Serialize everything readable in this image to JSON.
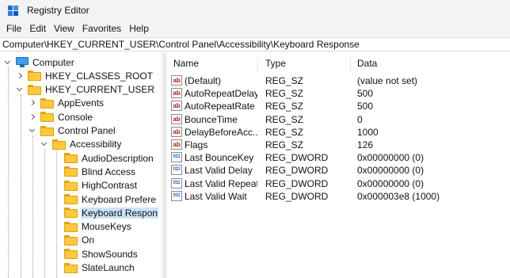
{
  "window": {
    "title": "Registry Editor"
  },
  "menu": [
    "File",
    "Edit",
    "View",
    "Favorites",
    "Help"
  ],
  "address": "Computer\\HKEY_CURRENT_USER\\Control Panel\\Accessibility\\Keyboard Response",
  "tree": [
    {
      "label": "Computer",
      "expander": "down",
      "icon": "computer-icon"
    },
    {
      "label": "HKEY_CLASSES_ROOT",
      "expander": "right",
      "icon": "folder-icon"
    },
    {
      "label": "HKEY_CURRENT_USER",
      "expander": "down",
      "icon": "folder-icon"
    },
    {
      "label": "AppEvents",
      "expander": "right",
      "icon": "folder-icon"
    },
    {
      "label": "Console",
      "expander": "right",
      "icon": "folder-icon"
    },
    {
      "label": "Control Panel",
      "expander": "down",
      "icon": "folder-icon"
    },
    {
      "label": "Accessibility",
      "expander": "down",
      "icon": "folder-icon"
    },
    {
      "label": "AudioDescription",
      "expander": "none",
      "icon": "folder-icon"
    },
    {
      "label": "Blind Access",
      "expander": "none",
      "icon": "folder-icon"
    },
    {
      "label": "HighContrast",
      "expander": "none",
      "icon": "folder-icon"
    },
    {
      "label": "Keyboard Prefere",
      "expander": "none",
      "icon": "folder-icon"
    },
    {
      "label": "Keyboard Respon",
      "expander": "none",
      "icon": "folder-icon",
      "selected": true
    },
    {
      "label": "MouseKeys",
      "expander": "none",
      "icon": "folder-icon"
    },
    {
      "label": "On",
      "expander": "none",
      "icon": "folder-icon"
    },
    {
      "label": "ShowSounds",
      "expander": "none",
      "icon": "folder-icon"
    },
    {
      "label": "SlateLaunch",
      "expander": "none",
      "icon": "folder-icon"
    }
  ],
  "columns": {
    "name": "Name",
    "type": "Type",
    "data": "Data"
  },
  "values": [
    {
      "name": "(Default)",
      "type": "REG_SZ",
      "data": "(value not set)",
      "icon": "string-value-icon",
      "icon_text": "ab"
    },
    {
      "name": "AutoRepeatDelay",
      "type": "REG_SZ",
      "data": "500",
      "icon": "string-value-icon",
      "icon_text": "ab"
    },
    {
      "name": "AutoRepeatRate",
      "type": "REG_SZ",
      "data": "500",
      "icon": "string-value-icon",
      "icon_text": "ab"
    },
    {
      "name": "BounceTime",
      "type": "REG_SZ",
      "data": "0",
      "icon": "string-value-icon",
      "icon_text": "ab"
    },
    {
      "name": "DelayBeforeAcc...",
      "type": "REG_SZ",
      "data": "1000",
      "icon": "string-value-icon",
      "icon_text": "ab"
    },
    {
      "name": "Flags",
      "type": "REG_SZ",
      "data": "126",
      "icon": "string-value-icon",
      "icon_text": "ab"
    },
    {
      "name": "Last BounceKey ...",
      "type": "REG_DWORD",
      "data": "0x00000000 (0)",
      "icon": "dword-value-icon",
      "icon_text": "011"
    },
    {
      "name": "Last Valid Delay",
      "type": "REG_DWORD",
      "data": "0x00000000 (0)",
      "icon": "dword-value-icon",
      "icon_text": "011"
    },
    {
      "name": "Last Valid Repeat",
      "type": "REG_DWORD",
      "data": "0x00000000 (0)",
      "icon": "dword-value-icon",
      "icon_text": "011"
    },
    {
      "name": "Last Valid Wait",
      "type": "REG_DWORD",
      "data": "0x000003e8 (1000)",
      "icon": "dword-value-icon",
      "icon_text": "011"
    }
  ],
  "colors": {
    "selection": "#cce4f7",
    "folder": "#ffc83d",
    "string_icon": "#b01818",
    "dword_icon": "#1e5fbf"
  }
}
